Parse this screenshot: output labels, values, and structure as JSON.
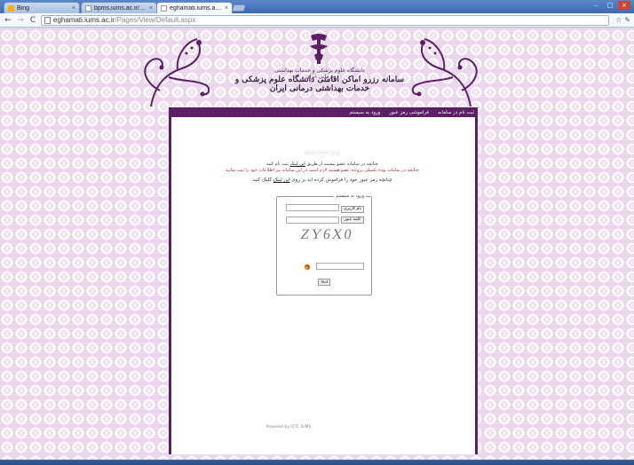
{
  "browser": {
    "tabs": [
      {
        "title": "Bing",
        "active": false,
        "favicon_color": "#f4b400"
      },
      {
        "title": "bpms.iums.ac.ir/Pag",
        "active": false,
        "favicon_color": "#ffffff"
      },
      {
        "title": "eghamati.iums.ac.ir",
        "active": true,
        "favicon_color": "#ffffff"
      }
    ],
    "close_glyph": "×",
    "url_host": "eghamati.iums.ac.ir",
    "url_path": "/Pages/View/Default.aspx",
    "nav": {
      "back": "←",
      "forward": "→",
      "reload": "C"
    },
    "right_icons": [
      "wrench-icon",
      "star-icon"
    ]
  },
  "header": {
    "title_line1": "دانشگاه علوم پزشکی و خدمات بهداشتی درمانی ایران",
    "title_line2": "سامانه رزرو اماکن اقامتی دانشگاه علوم پزشکی و خدمات بهداشتی درمانی ایران"
  },
  "menu": {
    "items": [
      "ثبت نام در سامانه",
      "فراموشی رمز عبور",
      "ورود به سیستم"
    ]
  },
  "content": {
    "welcome": "Welcome guy",
    "msg1_before": "چنانچه در سامانه عضو نیستید از طریق",
    "msg1_link": "این لینک",
    "msg1_after": "ثبت نام کنید",
    "msg2": "چنانچه در سامانه بوده تکمیلی پرونده عضو هستید لازم است در این سامانه نیز اطلاعات خود را ثبت نمایید",
    "msg3_before": "چنانچه رمز عبور خود را فراموش کرده اید بر روی",
    "msg3_link": "این لینک",
    "msg3_after": "کلیک کنید"
  },
  "login": {
    "legend": "ورود به سیستم",
    "username_label": "نام کاربری",
    "password_label": "کلمه عبور",
    "captcha_text": "ZY6X0",
    "submit_label": "ورود"
  },
  "footer": {
    "text": "Powered by ICTC IUMS"
  }
}
